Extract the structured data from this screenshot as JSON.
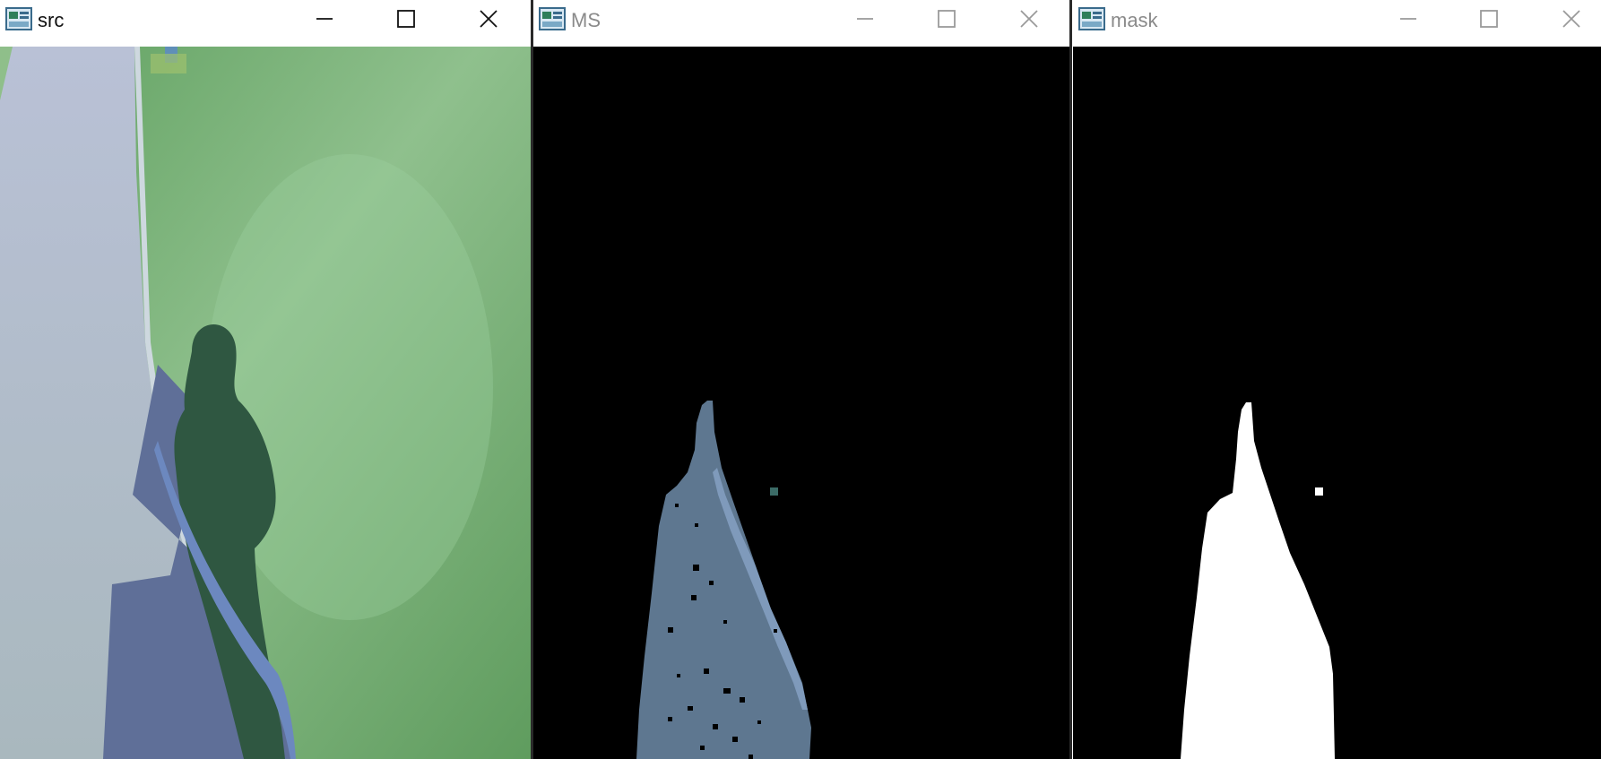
{
  "windows": [
    {
      "id": "src",
      "title": "src",
      "state": "active"
    },
    {
      "id": "ms",
      "title": "MS",
      "state": "inactive"
    },
    {
      "id": "mask",
      "title": "mask",
      "state": "inactive"
    }
  ],
  "controls": {
    "minimize": "minimize-icon",
    "maximize": "maximize-icon",
    "close": "close-icon"
  },
  "colors": {
    "image_background": "#000000",
    "mask_foreground": "#ffffff",
    "ms_segment": "#5e7790",
    "grass": "#76ad73",
    "road": "#b3bfcd"
  }
}
